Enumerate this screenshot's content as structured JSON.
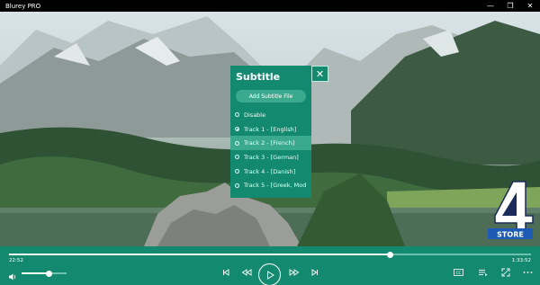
{
  "window": {
    "title": "Blurey PRO",
    "controls": {
      "minimize": "—",
      "maximize": "❐",
      "close": "✕"
    }
  },
  "subtitle_panel": {
    "title": "Subtitle",
    "add_button": "Add Subtitle File",
    "close_icon": "close-icon",
    "close_glyph": "✕",
    "tracks": [
      {
        "label": "Disable",
        "selected": false,
        "highlighted": false
      },
      {
        "label": "Track 1 - [English]",
        "selected": true,
        "highlighted": false
      },
      {
        "label": "Track 2 - [French]",
        "selected": false,
        "highlighted": true
      },
      {
        "label": "Track 3 - [German]",
        "selected": false,
        "highlighted": false
      },
      {
        "label": "Track 4 - [Danish]",
        "selected": false,
        "highlighted": false
      },
      {
        "label": "Track 5 - [Greek, Mod",
        "selected": false,
        "highlighted": false
      }
    ]
  },
  "logo": {
    "text": "STORE",
    "numeral": "4"
  },
  "player": {
    "time_elapsed": "22:52",
    "time_total": "1:33:52",
    "progress": 0.73,
    "volume": 0.6,
    "accent_color": "#138a6f"
  },
  "icons": {
    "volume": "volume-icon",
    "previous": "skip-previous-icon",
    "rewind": "rewind-icon",
    "play": "play-icon",
    "forward": "fast-forward-icon",
    "next": "skip-next-icon",
    "subtitles": "closed-caption-icon",
    "playlist": "playlist-icon",
    "fullscreen": "fullscreen-icon",
    "more": "more-icon"
  }
}
